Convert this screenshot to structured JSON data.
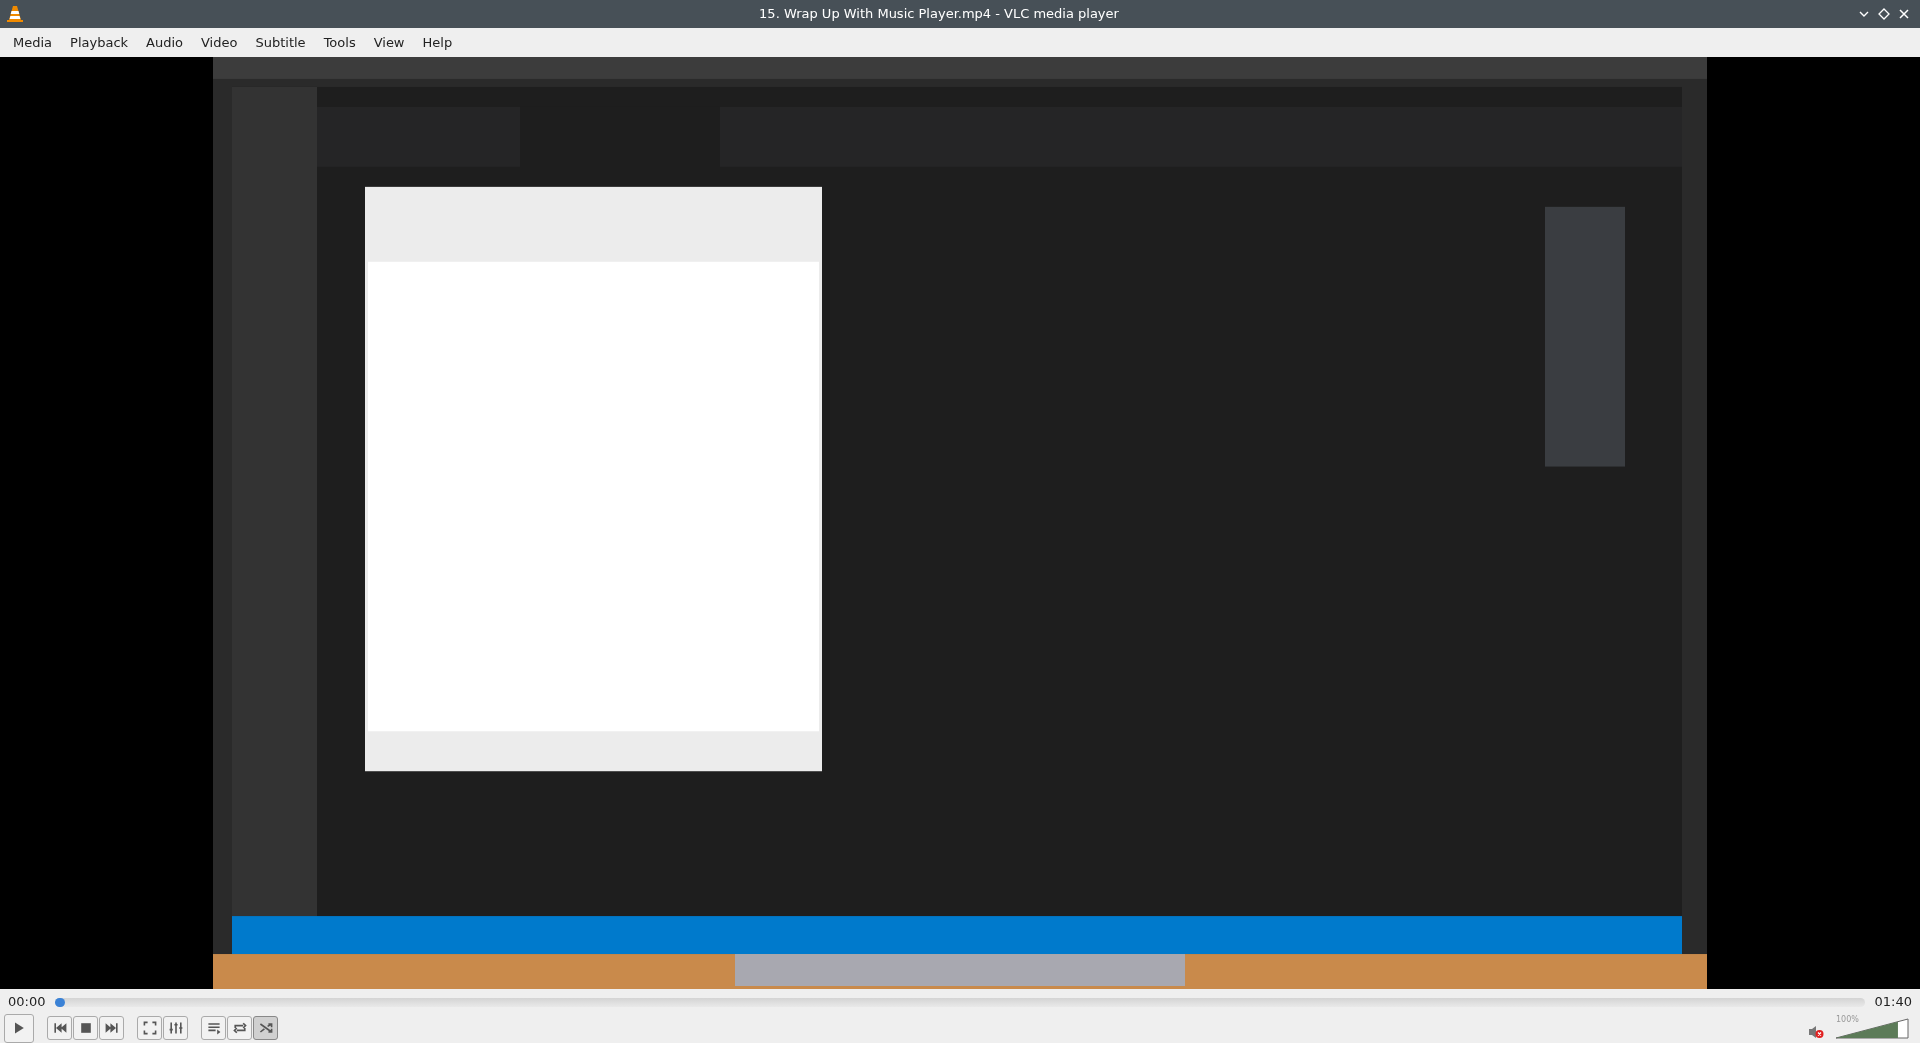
{
  "window": {
    "title": "15. Wrap Up With Music Player.mp4 - VLC media player"
  },
  "menu": [
    "Media",
    "Playback",
    "Audio",
    "Video",
    "Subtitle",
    "Tools",
    "View",
    "Help"
  ],
  "video": {
    "kind": "picture"
  },
  "seek": {
    "elapsed": "00:00",
    "total": "01:40",
    "level": 0
  },
  "controls": [
    {
      "kind": "play",
      "selected": false
    },
    {
      "kind": "previous",
      "selected": false
    },
    {
      "kind": "stop",
      "selected": false
    },
    {
      "kind": "next",
      "selected": false
    },
    {
      "kind": "fullscreen",
      "selected": false
    },
    {
      "kind": "extended",
      "selected": false
    },
    {
      "kind": "playlist",
      "selected": false
    },
    {
      "kind": "loop",
      "selected": false
    },
    {
      "kind": "shuffle",
      "selected": true
    }
  ],
  "volume": {
    "muted": true,
    "reading": "100%",
    "level": 0.86
  }
}
